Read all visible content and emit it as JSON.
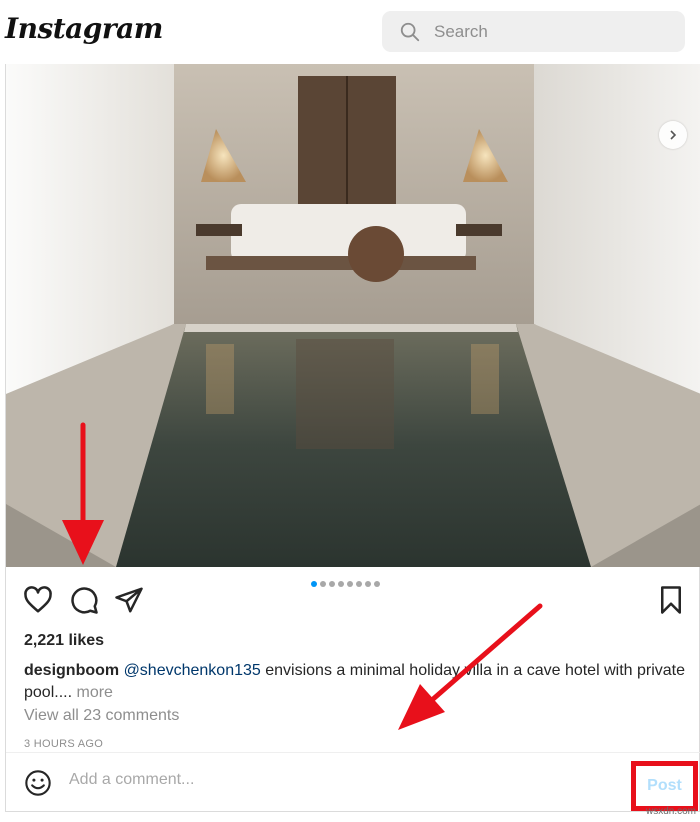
{
  "header": {
    "logo_text": "Instagram",
    "search_placeholder": "Search"
  },
  "post": {
    "likes": "2,221 likes",
    "username": "designboom",
    "mention": "@shevchenkon135",
    "caption_text": " envisions a minimal holiday villa in a cave hotel with private pool....",
    "more_label": "more",
    "view_comments": "View all 23 comments",
    "timestamp": "3 HOURS AGO",
    "carousel": {
      "total": 8,
      "active": 1
    }
  },
  "comment": {
    "placeholder": "Add a comment...",
    "post_label": "Post"
  },
  "annotations": {
    "arrow_color": "#e8101b",
    "highlight_color": "#e8101b"
  },
  "watermark": "wsxdn.com",
  "colors": {
    "link_blue": "#0095f6",
    "post_disabled": "#b2dffc",
    "muted": "#8e8e8e"
  }
}
